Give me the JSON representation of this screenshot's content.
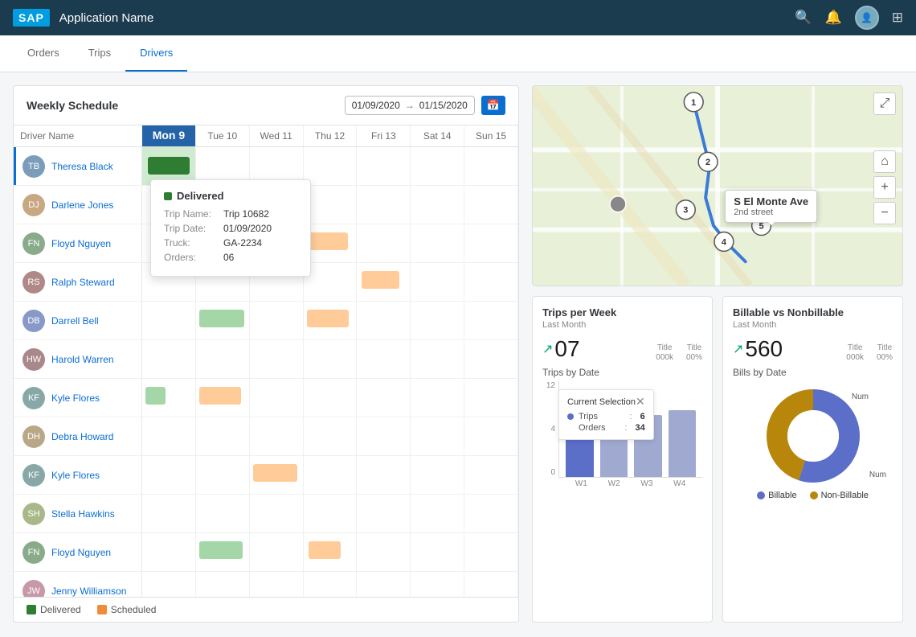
{
  "header": {
    "sap_label": "SAP",
    "app_name": "Application Name"
  },
  "nav": {
    "tabs": [
      "Orders",
      "Trips",
      "Drivers"
    ],
    "active": "Drivers"
  },
  "schedule": {
    "title": "Weekly Schedule",
    "date_start": "01/09/2020",
    "date_end": "01/15/2020",
    "days": [
      "Driver Name",
      "Mon 9",
      "Tue 10",
      "Wed 11",
      "Thu 12",
      "Fri 13",
      "Sat 14",
      "Sun 15"
    ],
    "drivers": [
      {
        "name": "Theresa Black",
        "avatar": "TB",
        "av_class": "av1"
      },
      {
        "name": "Darlene Jones",
        "avatar": "DJ",
        "av_class": "av2"
      },
      {
        "name": "Floyd Nguyen",
        "avatar": "FN",
        "av_class": "av3"
      },
      {
        "name": "Ralph Steward",
        "avatar": "RS",
        "av_class": "av4"
      },
      {
        "name": "Darrell Bell",
        "avatar": "DB",
        "av_class": "av5"
      },
      {
        "name": "Harold Warren",
        "avatar": "HW",
        "av_class": "av6"
      },
      {
        "name": "Kyle Flores",
        "avatar": "KF",
        "av_class": "av7"
      },
      {
        "name": "Debra Howard",
        "avatar": "DH",
        "av_class": "av8"
      },
      {
        "name": "Kyle Flores",
        "avatar": "KF",
        "av_class": "av7"
      },
      {
        "name": "Stella Hawkins",
        "avatar": "SH",
        "av_class": "av9"
      },
      {
        "name": "Floyd Nguyen",
        "avatar": "FN",
        "av_class": "av3"
      },
      {
        "name": "Jenny Williamson",
        "avatar": "JW",
        "av_class": "av10"
      }
    ],
    "legend": {
      "delivered": "Delivered",
      "scheduled": "Scheduled"
    }
  },
  "tooltip": {
    "status": "Delivered",
    "trip_name_label": "Trip Name:",
    "trip_name": "Trip 10682",
    "trip_date_label": "Trip Date:",
    "trip_date": "01/09/2020",
    "truck_label": "Truck:",
    "truck": "GA-2234",
    "orders_label": "Orders:",
    "orders": "06"
  },
  "map": {
    "popup_street": "S El Monte Ave",
    "popup_sub": "2nd street"
  },
  "trips_week": {
    "title": "Trips per Week",
    "subtitle": "Last Month",
    "value": "07",
    "label1": "Title",
    "val1": "000k",
    "label2": "Title",
    "val2": "00%"
  },
  "billable": {
    "title": "Billable vs Nonbillable",
    "subtitle": "Last Month",
    "value": "560",
    "label1": "Title",
    "val1": "000k",
    "label2": "Title",
    "val2": "00%"
  },
  "trips_date": {
    "title": "Trips by Date",
    "y_max": "12",
    "y_mid": "4",
    "y_min": "0",
    "x_labels": [
      "W1",
      "W2",
      "W3",
      "W4"
    ],
    "tooltip": {
      "label": "Current Selection",
      "trips_label": "Trips",
      "trips_val": "6",
      "orders_label": "Orders",
      "orders_val": "34"
    }
  },
  "bills_date": {
    "title": "Bills by Date",
    "billable_label": "Billable",
    "nonbillable_label": "Non-Billable",
    "num_label1": "Num",
    "num_label2": "Num"
  }
}
